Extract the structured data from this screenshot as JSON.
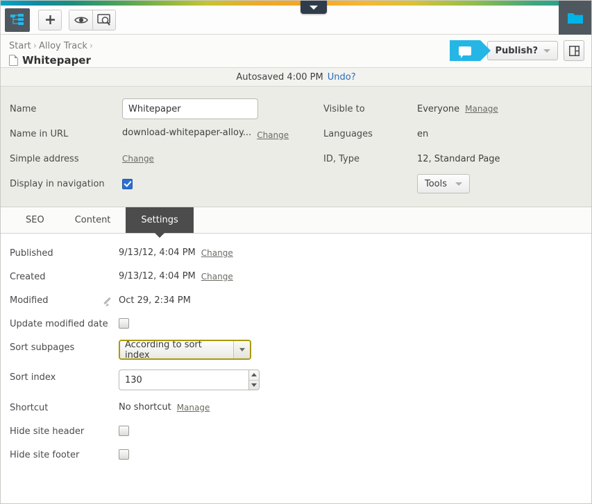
{
  "topbar": {
    "handle_icon": "chevron-down-icon",
    "buttons": [
      {
        "name": "sitemap-tree",
        "icon": "tree-structure-icon"
      },
      {
        "name": "add-page",
        "icon": "plus-icon"
      },
      {
        "name": "toggle-view",
        "icon": "eye-icon"
      },
      {
        "name": "preview",
        "icon": "preview-search-icon"
      }
    ],
    "right_button": {
      "name": "assets-folder",
      "icon": "folder-icon",
      "color": "#00b4e6"
    }
  },
  "header": {
    "breadcrumb": [
      "Start",
      "Alloy Track"
    ],
    "separator": "›",
    "page_title": "Whitepaper",
    "publish_label": "Publish?",
    "chat_icon": "comment-bubble-icon",
    "panel_icon": "panel-layout-icon"
  },
  "autosave": {
    "text": "Autosaved 4:00 PM",
    "undo_label": "Undo?"
  },
  "info": {
    "left": {
      "name_label": "Name",
      "name_value": "Whitepaper",
      "name_placeholder": "Name",
      "url_label": "Name in URL",
      "url_value": "download-whitepaper-alloy...",
      "url_change": "Change",
      "simple_address_label": "Simple address",
      "simple_address_change": "Change",
      "display_nav_label": "Display in navigation",
      "display_nav_checked": true
    },
    "right": {
      "visible_label": "Visible to",
      "visible_value": "Everyone",
      "visible_manage": "Manage",
      "languages_label": "Languages",
      "languages_value": "en",
      "idtype_label": "ID, Type",
      "idtype_value": "12, Standard Page",
      "tools_label": "Tools"
    }
  },
  "tabs": [
    {
      "label": "SEO",
      "active": false
    },
    {
      "label": "Content",
      "active": false
    },
    {
      "label": "Settings",
      "active": true
    }
  ],
  "settings": {
    "published_label": "Published",
    "published_value": "9/13/12, 4:04 PM",
    "published_change": "Change",
    "created_label": "Created",
    "created_value": "9/13/12, 4:04 PM",
    "created_change": "Change",
    "modified_label": "Modified",
    "modified_value": "Oct 29, 2:34 PM",
    "update_modified_label": "Update modified date",
    "update_modified_checked": false,
    "sort_subpages_label": "Sort subpages",
    "sort_subpages_value": "According to sort index",
    "sort_index_label": "Sort index",
    "sort_index_value": "130",
    "shortcut_label": "Shortcut",
    "shortcut_value": "No shortcut",
    "shortcut_manage": "Manage",
    "hide_header_label": "Hide site header",
    "hide_header_checked": false,
    "hide_footer_label": "Hide site footer",
    "hide_footer_checked": false
  },
  "colors": {
    "accent": "#25b6e6",
    "focus_border": "#a89a0a",
    "active_tab": "#4c4c4c",
    "checkbox_checked": "#2a6fd6"
  }
}
